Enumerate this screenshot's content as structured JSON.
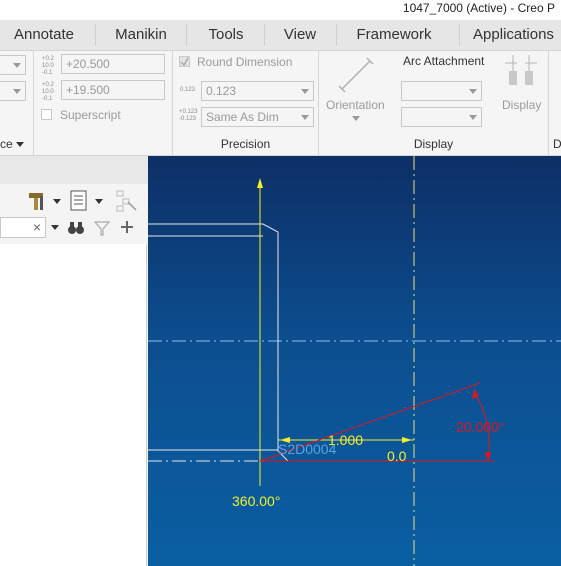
{
  "window": {
    "title": "1047_7000 (Active) - Creo P"
  },
  "tabs": [
    {
      "label": "Annotate"
    },
    {
      "label": "Manikin"
    },
    {
      "label": "Tools"
    },
    {
      "label": "View"
    },
    {
      "label": "Framework"
    },
    {
      "label": "Applications"
    }
  ],
  "ribbon": {
    "tolerance": {
      "upper_value": "+20.500",
      "lower_value": "+19.500",
      "superscript_label": "Superscript",
      "icon_upper_text": "+0.2 10.0 -0.1",
      "icon_lower_text": "+0.2 10.0 -0.1"
    },
    "precision": {
      "round_dimension_label": "Round Dimension",
      "decimal_value": "0.123",
      "tolerance_decimal_value": "Same As Dim",
      "icon_decimal_text": "0.123",
      "icon_tol_text": "+0.123 -0.123",
      "group_label": "Precision"
    },
    "display": {
      "orientation_label": "Orientation",
      "arc_attachment_label": "Arc Attachment",
      "display_label": "Display",
      "group_label": "Display",
      "next_group_label": "D"
    },
    "left_group_label": "ce"
  },
  "panel": {
    "filter_clear": "×"
  },
  "drawing": {
    "dim_length": "1.000",
    "dim_angle": "20.000°",
    "dim_angle_bottom": "360.00°",
    "dim_zero": "0.0",
    "symbol_label": "S2D0004"
  },
  "colors": {
    "canvas_top": "#0d2f66",
    "canvas_bottom": "#0a5fa3",
    "dimension_yellow": "#f5ef2b",
    "dimension_red": "#e0161d",
    "centerline_cyan": "#7ec8ec",
    "geometry_white": "#e8e8e8"
  }
}
